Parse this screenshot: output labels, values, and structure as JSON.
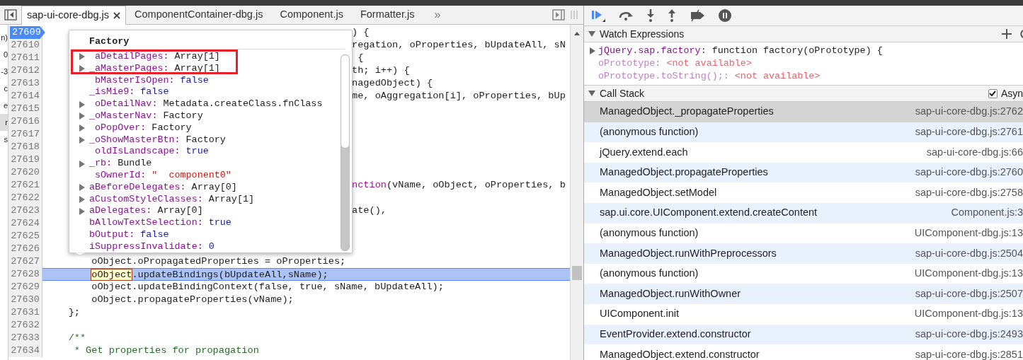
{
  "editor_tabs": {
    "tabs": [
      {
        "label": "sap-ui-core-dbg.js",
        "selected": true,
        "closable": true
      },
      {
        "label": "ComponentContainer-dbg.js",
        "selected": false,
        "closable": false
      },
      {
        "label": "Component.js",
        "selected": false,
        "closable": false
      },
      {
        "label": "Formatter.js",
        "selected": false,
        "closable": false
      }
    ],
    "overflow": "»"
  },
  "navigator_fragments": [
    {
      "text": "n)",
      "selected": false
    },
    {
      "text": "0",
      "selected": false
    },
    {
      "text": "-3",
      "selected": false
    },
    {
      "text": "c",
      "selected": false
    },
    {
      "text": "e",
      "selected": false
    },
    {
      "text": "r",
      "selected": true
    },
    {
      "text": "s",
      "selected": false
    }
  ],
  "code_lines": [
    {
      "number": "27609",
      "breakpoint": true,
      "current": false,
      "kind": "partial",
      "segments": [
        {
          "text": ") {",
          "kind": "plain"
        }
      ]
    },
    {
      "number": "27610",
      "breakpoint": false,
      "current": false,
      "kind": "partial",
      "segments": [
        {
          "text": "regation, oProperties, bUpdateAll, sN",
          "kind": "plain"
        }
      ]
    },
    {
      "number": "27611",
      "breakpoint": false,
      "current": false,
      "kind": "partial",
      "segments": [
        {
          "text": " {",
          "kind": "plain"
        }
      ]
    },
    {
      "number": "27612",
      "breakpoint": false,
      "current": false,
      "kind": "partial",
      "segments": [
        {
          "text": "th; i++) {",
          "kind": "plain"
        }
      ]
    },
    {
      "number": "27613",
      "breakpoint": false,
      "current": false,
      "kind": "partial",
      "segments": [
        {
          "text": "nagedObject) {",
          "kind": "plain"
        }
      ]
    },
    {
      "number": "27614",
      "breakpoint": false,
      "current": false,
      "kind": "partial",
      "segments": [
        {
          "text": "me, oAggregation[i], oProperties, bUp",
          "kind": "plain"
        }
      ]
    },
    {
      "number": "27615",
      "breakpoint": false,
      "current": false,
      "kind": "partial"
    },
    {
      "number": "27616",
      "breakpoint": false,
      "current": false,
      "kind": "partial"
    },
    {
      "number": "27617",
      "breakpoint": false,
      "current": false,
      "kind": "partial"
    },
    {
      "number": "27618",
      "breakpoint": false,
      "current": false,
      "kind": "partial"
    },
    {
      "number": "27619",
      "breakpoint": false,
      "current": false,
      "kind": "partial"
    },
    {
      "number": "27620",
      "breakpoint": false,
      "current": false,
      "kind": "partial"
    },
    {
      "number": "27621",
      "breakpoint": false,
      "current": false,
      "kind": "partial",
      "segments": [
        {
          "text": "nction",
          "kind": "keyword"
        },
        {
          "text": "(vName, oObject, oProperties, b",
          "kind": "plain"
        }
      ]
    },
    {
      "number": "27622",
      "breakpoint": false,
      "current": false,
      "kind": "partial"
    },
    {
      "number": "27623",
      "breakpoint": false,
      "current": false,
      "kind": "partial",
      "segments": [
        {
          "text": "ate(),",
          "kind": "plain"
        }
      ]
    },
    {
      "number": "27624",
      "breakpoint": false,
      "current": false,
      "kind": "partial"
    },
    {
      "number": "27625",
      "breakpoint": false,
      "current": false,
      "kind": "partial"
    },
    {
      "number": "27626",
      "breakpoint": false,
      "current": false,
      "kind": "partial"
    },
    {
      "number": "27627",
      "breakpoint": false,
      "current": false,
      "kind": "full",
      "segments": [
        {
          "text": "        oObject.oPropagatedProperties = oProperties;",
          "kind": "plain"
        }
      ]
    },
    {
      "number": "27628",
      "breakpoint": false,
      "current": true,
      "kind": "full",
      "segments": [
        {
          "text": "        oObject",
          "kind": "hover"
        },
        {
          "text": ".updateBindings(bUpdateAll,sName);",
          "kind": "plain"
        }
      ]
    },
    {
      "number": "27629",
      "breakpoint": false,
      "current": false,
      "kind": "full",
      "segments": [
        {
          "text": "        oObject.updateBindingContext(false, true, sName, bUpdateAll);",
          "kind": "plain"
        }
      ]
    },
    {
      "number": "27630",
      "breakpoint": false,
      "current": false,
      "kind": "full",
      "segments": [
        {
          "text": "        oObject.propagateProperties(vName);",
          "kind": "plain"
        }
      ]
    },
    {
      "number": "27631",
      "breakpoint": false,
      "current": false,
      "kind": "full",
      "segments": [
        {
          "text": "    };",
          "kind": "plain"
        }
      ]
    },
    {
      "number": "27632",
      "breakpoint": false,
      "current": false,
      "kind": "full"
    },
    {
      "number": "27633",
      "breakpoint": false,
      "current": false,
      "kind": "full",
      "segments": [
        {
          "text": "    /**",
          "kind": "comment"
        }
      ]
    },
    {
      "number": "27634",
      "breakpoint": false,
      "current": false,
      "kind": "full",
      "segments": [
        {
          "text": "     * Get properties for propagation",
          "kind": "comment"
        }
      ]
    }
  ],
  "popover": {
    "title": "Factory",
    "properties": [
      {
        "name": " aDetailPages:",
        "value": "Array[1]",
        "kind": "object",
        "expandable": true
      },
      {
        "name": "_aMasterPages:",
        "value": "Array[1]",
        "kind": "object",
        "expandable": true
      },
      {
        "name": " bMasterIsOpen:",
        "value": "false",
        "kind": "literal",
        "expandable": false
      },
      {
        "name": "_isMie9:",
        "value": "false",
        "kind": "literal",
        "expandable": false
      },
      {
        "name": " oDetailNav:",
        "value": "Metadata.createClass.fnClass",
        "kind": "object",
        "expandable": true
      },
      {
        "name": "_oMasterNav:",
        "value": "Factory",
        "kind": "object",
        "expandable": true
      },
      {
        "name": " oPopOver:",
        "value": "Factory",
        "kind": "object",
        "expandable": true
      },
      {
        "name": "_oShowMasterBtn:",
        "value": "Factory",
        "kind": "object",
        "expandable": true
      },
      {
        "name": " oldIsLandscape:",
        "value": "true",
        "kind": "literal",
        "expandable": false
      },
      {
        "name": "_rb:",
        "value": "Bundle",
        "kind": "object",
        "expandable": true
      },
      {
        "name": " sOwnerId:",
        "value": "\"  component0\"",
        "kind": "string",
        "expandable": false
      },
      {
        "name": "aBeforeDelegates:",
        "value": "Array[0]",
        "kind": "object",
        "expandable": true
      },
      {
        "name": "aCustomStyleClasses:",
        "value": "Array[1]",
        "kind": "object",
        "expandable": true
      },
      {
        "name": "aDelegates:",
        "value": "Array[0]",
        "kind": "object",
        "expandable": true
      },
      {
        "name": "bAllowTextSelection:",
        "value": "true",
        "kind": "literal",
        "expandable": false
      },
      {
        "name": "bOutput:",
        "value": "false",
        "kind": "literal",
        "expandable": false
      },
      {
        "name": "iSuppressInvalidate:",
        "value": "0",
        "kind": "literal",
        "expandable": false
      }
    ]
  },
  "watch_expressions": {
    "title": "Watch Expressions",
    "expanded": true,
    "items": [
      {
        "name": "jQuery.sap.factory:",
        "value": "function factory(oPrototype) {",
        "available": true,
        "expandable": true
      },
      {
        "name": "oPrototype:",
        "value": "<not available>",
        "available": false,
        "expandable": false
      },
      {
        "name": "oPrototype.toString();:",
        "value": "<not available>",
        "available": false,
        "expandable": false
      }
    ]
  },
  "call_stack": {
    "title": "Call Stack",
    "expanded": true,
    "async": {
      "label": "Asyn",
      "checked": true
    },
    "frames": [
      {
        "function": "ManagedObject._propagateProperties",
        "location": "sap-ui-core-dbg.js:2762",
        "selected": true
      },
      {
        "function": "(anonymous function)",
        "location": "sap-ui-core-dbg.js:2761",
        "selected": false
      },
      {
        "function": "jQuery.extend.each",
        "location": "sap-ui-core-dbg.js:66",
        "selected": false
      },
      {
        "function": "ManagedObject.propagateProperties",
        "location": "sap-ui-core-dbg.js:2760",
        "selected": false
      },
      {
        "function": "ManagedObject.setModel",
        "location": "sap-ui-core-dbg.js:2758",
        "selected": false
      },
      {
        "function": "sap.ui.core.UIComponent.extend.createContent",
        "location": "Component.js:3",
        "selected": false
      },
      {
        "function": "(anonymous function)",
        "location": "UIComponent-dbg.js:13",
        "selected": false
      },
      {
        "function": "ManagedObject.runWithPreprocessors",
        "location": "sap-ui-core-dbg.js:2504",
        "selected": false
      },
      {
        "function": "(anonymous function)",
        "location": "UIComponent-dbg.js:13",
        "selected": false
      },
      {
        "function": "ManagedObject.runWithOwner",
        "location": "sap-ui-core-dbg.js:2507",
        "selected": false
      },
      {
        "function": "UIComponent.init",
        "location": "UIComponent-dbg.js:13",
        "selected": false
      },
      {
        "function": "EventProvider.extend.constructor",
        "location": "sap-ui-core-dbg.js:2493",
        "selected": false
      },
      {
        "function": "ManagedObject.extend.constructor",
        "location": "sap-ui-core-dbg.js:2851",
        "selected": false
      }
    ]
  }
}
